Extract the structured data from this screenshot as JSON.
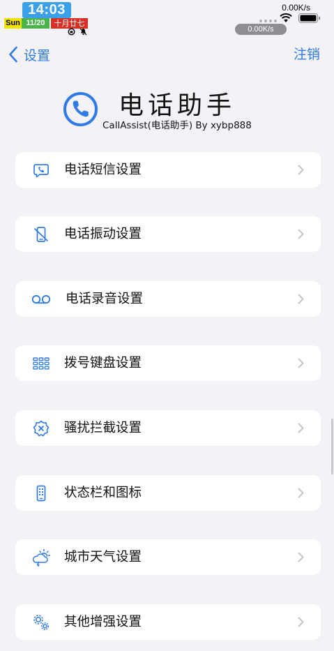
{
  "status_bar": {
    "time": "14:03",
    "day": "Sun",
    "date": "11/20",
    "lunar": "十月廿七",
    "net_speed_top": "0.00K/s",
    "net_speed_pill": "0.00K/s"
  },
  "nav": {
    "back_label": "设置",
    "right_label": "注销"
  },
  "header": {
    "title": "电话助手",
    "subtitle": "CallAssist(电话助手) By xybp888"
  },
  "menu": [
    {
      "label": "电话短信设置",
      "icon": "phone-message-icon"
    },
    {
      "label": "电话振动设置",
      "icon": "phone-vibrate-icon"
    },
    {
      "label": "电话录音设置",
      "icon": "voicemail-icon"
    },
    {
      "label": "拨号键盘设置",
      "icon": "dialpad-icon"
    },
    {
      "label": "骚扰拦截设置",
      "icon": "block-badge-icon"
    },
    {
      "label": "状态栏和图标",
      "icon": "phone-device-icon"
    },
    {
      "label": "城市天气设置",
      "icon": "weather-storm-icon"
    },
    {
      "label": "其他增强设置",
      "icon": "gears-icon"
    }
  ],
  "colors": {
    "accent": "#2f7ae5",
    "background": "#f2f2f7",
    "card": "#ffffff",
    "time_bg": "#3aa0e8",
    "day_bg": "#f1e300",
    "date_bg": "#4ab44a",
    "lunar_bg": "#d93025"
  }
}
